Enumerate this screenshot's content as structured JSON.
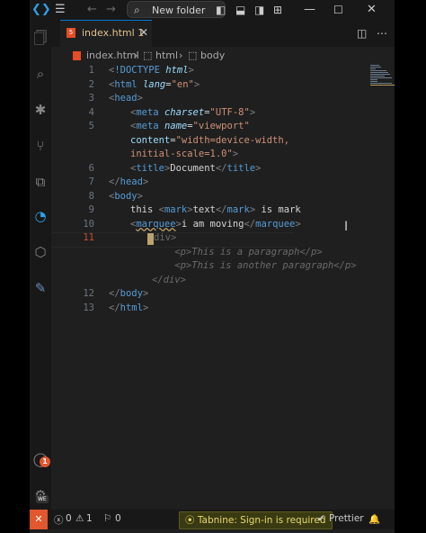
{
  "titlebar": {
    "search_label": "New folder",
    "icons": [
      "vscode-logo",
      "hamburger-menu",
      "back-arrow",
      "forward-arrow",
      "search",
      "layout-sidebar",
      "layout-panel",
      "layout-secondary",
      "layout-custom",
      "minimize",
      "maximize",
      "close"
    ]
  },
  "activity_bar": {
    "icons": [
      "explorer",
      "search",
      "debug",
      "source-control",
      "extensions",
      "edge-devtools",
      "remote-explorer",
      "python",
      "accounts",
      "settings"
    ],
    "accounts_badge": "1",
    "settings_badge": "WE"
  },
  "tab": {
    "icon_text": "5",
    "label": "index.html",
    "modified_count": "1"
  },
  "breadcrumb": [
    "index.html",
    "html",
    "body"
  ],
  "editor": {
    "lines": [
      {
        "n": "1"
      },
      {
        "n": "2"
      },
      {
        "n": "3"
      },
      {
        "n": "4"
      },
      {
        "n": "5"
      },
      {
        "n": ""
      },
      {
        "n": ""
      },
      {
        "n": "6"
      },
      {
        "n": "7"
      },
      {
        "n": "8"
      },
      {
        "n": "9"
      },
      {
        "n": "10"
      },
      {
        "n": "11"
      },
      {
        "n": ""
      },
      {
        "n": ""
      },
      {
        "n": ""
      },
      {
        "n": "12"
      },
      {
        "n": "13"
      }
    ],
    "current_line": "11"
  },
  "statusbar": {
    "errors": "0",
    "warnings": "1",
    "ports": "0",
    "tabnine": "Tabnine: Sign-in is required",
    "prettier": "Prettier"
  },
  "colors": {
    "accent": "#0078d4",
    "remote": "#e2572e",
    "tag": "#569cd6",
    "attribute": "#9cdcfe",
    "string": "#ce9178"
  }
}
